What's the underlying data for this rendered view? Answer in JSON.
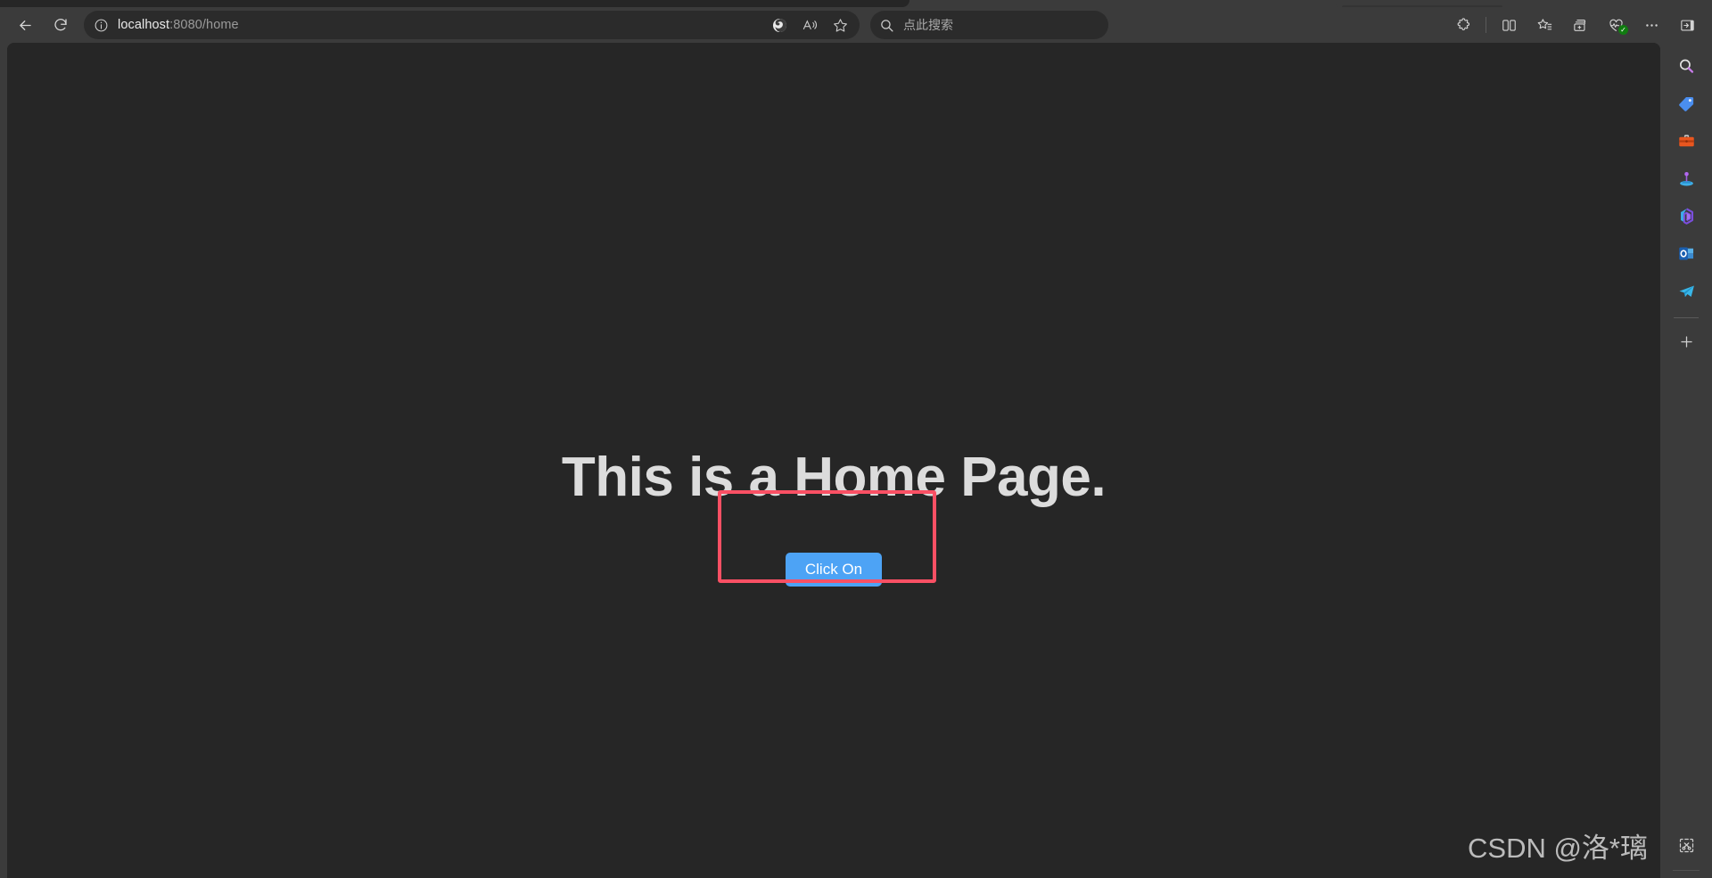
{
  "browser": {
    "nav": {
      "back_label": "Back",
      "refresh_label": "Refresh"
    },
    "address_bar": {
      "site_info_icon": "info-circle-icon",
      "url_host": "localhost",
      "url_rest": ":8080/home",
      "full_url": "localhost:8080/home",
      "actions": [
        {
          "name": "copilot-icon",
          "label": "Copilot"
        },
        {
          "name": "read-aloud-icon",
          "label": "Read aloud"
        },
        {
          "name": "favorite-star-icon",
          "label": "Add this page to favorites"
        }
      ]
    },
    "search": {
      "placeholder": "点此搜索",
      "icon": "search-icon"
    },
    "toolbar_right": [
      {
        "name": "extensions-icon",
        "label": "Extensions"
      },
      {
        "name": "split-screen-icon",
        "label": "Split screen"
      },
      {
        "name": "favorites-list-icon",
        "label": "Favorites"
      },
      {
        "name": "collections-icon",
        "label": "Collections"
      },
      {
        "name": "browser-essentials-icon",
        "label": "Browser essentials"
      },
      {
        "name": "settings-more-icon",
        "label": "Settings and more"
      },
      {
        "name": "sidebar-toggle-icon",
        "label": "Toggle sidebar"
      }
    ],
    "sidebar": {
      "items": [
        {
          "name": "sidebar-search-icon",
          "label": "Search"
        },
        {
          "name": "sidebar-shopping-icon",
          "label": "Shopping"
        },
        {
          "name": "sidebar-tools-icon",
          "label": "Tools"
        },
        {
          "name": "sidebar-games-icon",
          "label": "Games"
        },
        {
          "name": "sidebar-office-icon",
          "label": "Microsoft 365"
        },
        {
          "name": "sidebar-outlook-icon",
          "label": "Outlook"
        },
        {
          "name": "sidebar-telegram-icon",
          "label": "Telegram"
        }
      ],
      "add_label": "+",
      "bottom_item": {
        "name": "web-capture-icon",
        "label": "Web capture"
      }
    }
  },
  "page": {
    "heading": "This is a Home Page.",
    "button_label": "Click On",
    "background_color": "#262626",
    "button_color": "#4da3f5",
    "heading_color": "#dcdcdc"
  },
  "annotation": {
    "color": "#fa5064",
    "target": "Click On"
  },
  "watermark": {
    "text": "CSDN @洛*璃"
  }
}
